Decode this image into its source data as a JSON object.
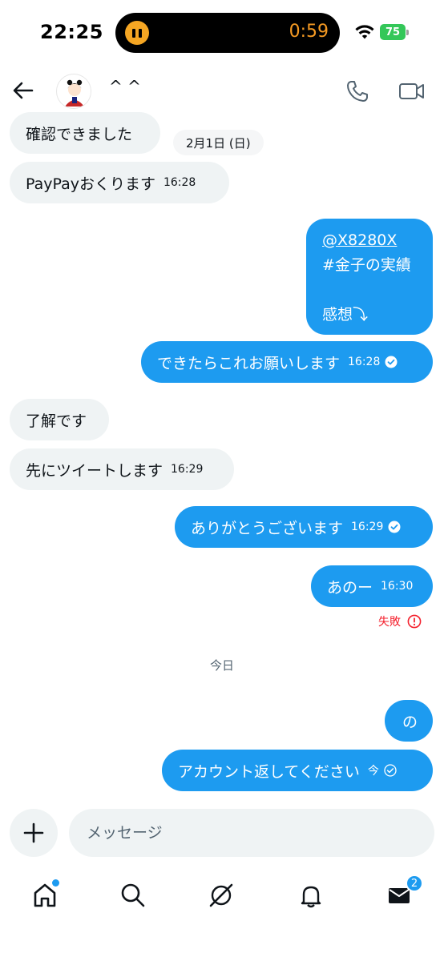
{
  "status_bar": {
    "time": "22:25",
    "timer": "0:59",
    "battery": "75",
    "icons": [
      "pause-icon",
      "wifi-icon",
      "battery-icon"
    ]
  },
  "header": {
    "name": "^ ^",
    "icons": [
      "back-arrow-icon",
      "phone-icon",
      "video-icon"
    ]
  },
  "messages": [
    {
      "id": "m1",
      "direction": "received",
      "text": "確認できました",
      "time": ""
    },
    {
      "id": "m2",
      "direction": "received",
      "text": "PayPayおくります",
      "time": "16:28"
    },
    {
      "id": "m3",
      "direction": "sent",
      "lines": [
        "@X8280X",
        "#金子の実績",
        "",
        "感想⤵︎"
      ],
      "time": ""
    },
    {
      "id": "m4",
      "direction": "sent",
      "text": "できたらこれお願いします",
      "time": "16:28",
      "status": "sent"
    },
    {
      "id": "m5",
      "direction": "received",
      "text": "了解です",
      "time": ""
    },
    {
      "id": "m6",
      "direction": "received",
      "text": "先にツイートします",
      "time": "16:29"
    },
    {
      "id": "m7",
      "direction": "sent",
      "text": "ありがとうございます",
      "time": "16:29",
      "status": "sent"
    },
    {
      "id": "m8",
      "direction": "sent",
      "text": "あのー",
      "time": "16:30",
      "status": "failed"
    },
    {
      "id": "m9",
      "direction": "sent",
      "text": "の",
      "time": ""
    },
    {
      "id": "m10",
      "direction": "sent",
      "text": "アカウント返してください",
      "time": "今",
      "status": "pending"
    }
  ],
  "date_separator": "2月1日 (日)",
  "failed_label": "失敗",
  "today_label": "今日",
  "composer": {
    "placeholder": "メッセージ"
  },
  "bottom_nav": {
    "items": [
      "home",
      "search",
      "grok",
      "notifications",
      "messages"
    ],
    "messages_badge": "2"
  },
  "colors": {
    "accent": "#1d9bf0",
    "received_bubble": "#eff3f4",
    "error": "#f4212e",
    "battery": "#34c759"
  }
}
